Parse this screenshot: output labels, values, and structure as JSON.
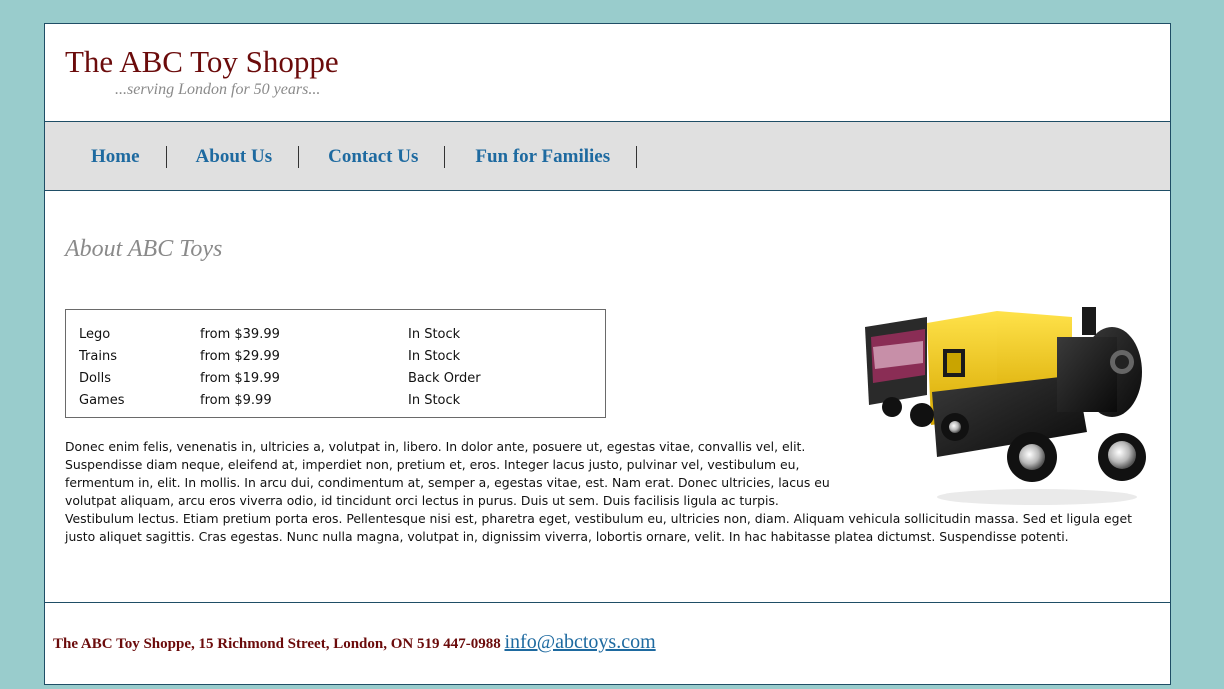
{
  "header": {
    "title": "The ABC Toy Shoppe",
    "tagline": "...serving London for 50 years..."
  },
  "nav": {
    "items": [
      {
        "label": "Home"
      },
      {
        "label": "About Us"
      },
      {
        "label": "Contact Us"
      },
      {
        "label": "Fun for Families"
      }
    ]
  },
  "main": {
    "heading": "About ABC Toys",
    "toys": [
      {
        "name": "Lego",
        "price": "from $39.99",
        "status": "In Stock"
      },
      {
        "name": "Trains",
        "price": "from $29.99",
        "status": "In Stock"
      },
      {
        "name": "Dolls",
        "price": "from $19.99",
        "status": "Back Order"
      },
      {
        "name": "Games",
        "price": "from $9.99",
        "status": "In Stock"
      }
    ],
    "image_icon": "toy-train-image",
    "paragraph": "Donec enim felis, venenatis in, ultricies a, volutpat in, libero. In dolor ante, posuere ut, egestas vitae, convallis vel, elit. Suspendisse diam neque, eleifend at, imperdiet non, pretium et, eros. Integer lacus justo, pulvinar vel, vestibulum eu, fermentum in, elit. In mollis. In arcu dui, condimentum at, semper a, egestas vitae, est. Nam erat. Donec ultricies, lacus eu volutpat aliquam, arcu eros viverra odio, id tincidunt orci lectus in purus. Duis ut sem. Duis facilisis ligula ac turpis. Vestibulum lectus. Etiam pretium porta eros. Pellentesque nisi est, pharetra eget, vestibulum eu, ultricies non, diam. Aliquam vehicula sollicitudin massa. Sed et ligula eget justo aliquet sagittis. Cras egestas. Nunc nulla magna, volutpat in, dignissim viverra, lobortis ornare, velit. In hac habitasse platea dictumst. Suspendisse potenti."
  },
  "footer": {
    "address": "The ABC Toy Shoppe, 15 Richmond Street, London, ON 519 447-0988",
    "email": "info@abctoys.com"
  },
  "colors": {
    "background": "#99cccc",
    "title": "#6b0b0b",
    "link": "#1e6aa0",
    "nav_bg": "#e0e0e0"
  }
}
